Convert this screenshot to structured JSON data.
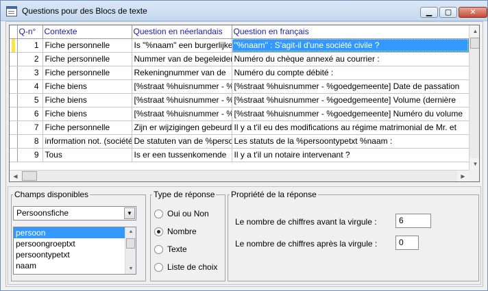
{
  "window": {
    "title": "Questions pour des Blocs de texte",
    "buttons": {
      "minimize": "▁",
      "maximize": "▢",
      "close": "✕"
    }
  },
  "grid": {
    "columns": [
      "Q-n°",
      "Contexte",
      "Question en néerlandais",
      "Question en français"
    ],
    "rows": [
      {
        "num": "1",
        "contexte": "Fiche personnelle",
        "nl": "Is \"%naam\" een burgerlijke",
        "fr": "\"%naam\" : S'agit-il d'une société civile  ?"
      },
      {
        "num": "2",
        "contexte": "Fiche personnelle",
        "nl": "Nummer van de begeleidende",
        "fr": "Numéro du chèque annexé au courrier :"
      },
      {
        "num": "3",
        "contexte": "Fiche personnelle",
        "nl": "Rekeningnummer van de",
        "fr": "Numéro du compte débité :"
      },
      {
        "num": "4",
        "contexte": "Fiche biens",
        "nl": "[%straat %huisnummer - %",
        "fr": "[%straat %huisnummer - %goedgemeente]  Date de passation"
      },
      {
        "num": "5",
        "contexte": "Fiche biens",
        "nl": "[%straat %huisnummer - %",
        "fr": "[%straat %huisnummer - %goedgemeente]  Volume (dernière"
      },
      {
        "num": "6",
        "contexte": "Fiche biens",
        "nl": "[%straat %huisnummer - %",
        "fr": "[%straat %huisnummer - %goedgemeente]  Numéro du volume"
      },
      {
        "num": "7",
        "contexte": "Fiche personnelle",
        "nl": "Zijn er wijzigingen gebeurd",
        "fr": "Il y a t'il eu des modifications au régime matrimonial de Mr. et"
      },
      {
        "num": "8",
        "contexte": "information not. (société)",
        "nl": "De statuten van de %persoon",
        "fr": "Les statuts de la %persoontypetxt %naam :"
      },
      {
        "num": "9",
        "contexte": "Tous",
        "nl": "Is er een tussenkomende",
        "fr": "Il y a t'il un notaire intervenant  ?"
      }
    ]
  },
  "champs": {
    "legend": "Champs disponibles",
    "selected": "Persoonsfiche",
    "items": [
      "persoon",
      "persoongroeptxt",
      "persoontypetxt",
      "naam"
    ]
  },
  "type_reponse": {
    "legend": "Type de réponse",
    "options": [
      "Oui ou Non",
      "Nombre",
      "Texte",
      "Liste de choix"
    ],
    "selected_index": 1
  },
  "propriete": {
    "legend": "Propriété de la réponse",
    "avant_label": "Le nombre de chiffres avant la virgule :",
    "avant_value": "6",
    "apres_label": "Le nombre de chiffres après la virgule :",
    "apres_value": "0"
  }
}
